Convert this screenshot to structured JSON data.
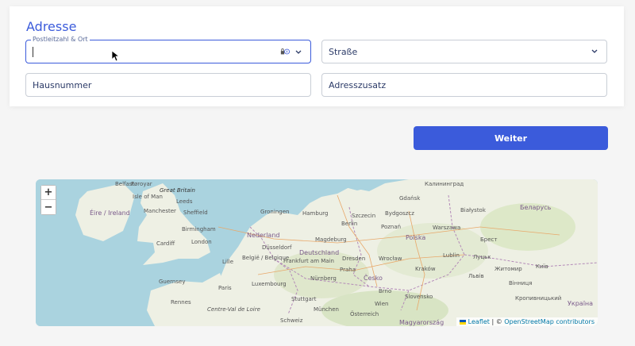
{
  "section": {
    "title": "Adresse"
  },
  "fields": {
    "postcode_city": {
      "label": "Postleitzahl & Ort",
      "value": ""
    },
    "street": {
      "placeholder": "Straße"
    },
    "house_number": {
      "placeholder": "Hausnummer"
    },
    "address_extra": {
      "placeholder": "Adresszusatz"
    }
  },
  "button": {
    "label": "Weiter"
  },
  "map": {
    "zoom_in": "+",
    "zoom_out": "−",
    "attribution": {
      "leaflet": "Leaflet",
      "separator": " | © ",
      "osm": "OpenStreetMap contributors"
    },
    "labels": {
      "faroe": "Føroyar",
      "isle_of_man": "Isle of Man",
      "great_britain": "Great Britain",
      "belfast": "Belfast",
      "leeds": "Leeds",
      "ireland": "Éire / Ireland",
      "manchester": "Manchester",
      "sheffield": "Sheffield",
      "birmingham": "Birmingham",
      "cardiff": "Cardiff",
      "london": "London",
      "lille": "Lille",
      "nederland": "Nederland",
      "groningen": "Groningen",
      "hamburg": "Hamburg",
      "szczecin": "Szczecin",
      "gdansk": "Gdańsk",
      "kaliningrad": "Калининград",
      "bydgoszcz": "Bydgoszcz",
      "belarus": "Беларусь",
      "bialystok": "Białystok",
      "berlin": "Berlin",
      "poznan": "Poznań",
      "warszawa": "Warszawa",
      "polska": "Polska",
      "brest": "Брест",
      "duesseldorf": "Düsseldorf",
      "magdeburg": "Magdeburg",
      "belgie": "België / Belgique",
      "frankfurt": "Frankfurt am Main",
      "deutschland": "Deutschland",
      "dresden": "Dresden",
      "wroclaw": "Wrocław",
      "lublin": "Lublin",
      "lutsk": "Луцьк",
      "zhytomyr": "Житомир",
      "kyiv": "Київ",
      "luxembourg": "Luxembourg",
      "praha": "Praha",
      "krakow": "Kraków",
      "lviv": "Львів",
      "paris": "Paris",
      "nuernberg": "Nürnberg",
      "cesko": "Česko",
      "vinnytsia": "Вінниця",
      "stuttgart": "Stuttgart",
      "brno": "Brno",
      "slovensko": "Slovensko",
      "kropyvnytskyi": "Кропивницький",
      "guernsey": "Guernsey",
      "rennes": "Rennes",
      "muenchen": "München",
      "wien": "Wien",
      "ukraina": "Україна",
      "oesterreich": "Österreich",
      "magyarorszag": "Magyarország",
      "schweiz": "Schweiz",
      "centre": "Centre-Val de Loire"
    }
  },
  "colors": {
    "accent": "#3b5bdb",
    "sea": "#aad3df",
    "land": "#eef0e4"
  }
}
